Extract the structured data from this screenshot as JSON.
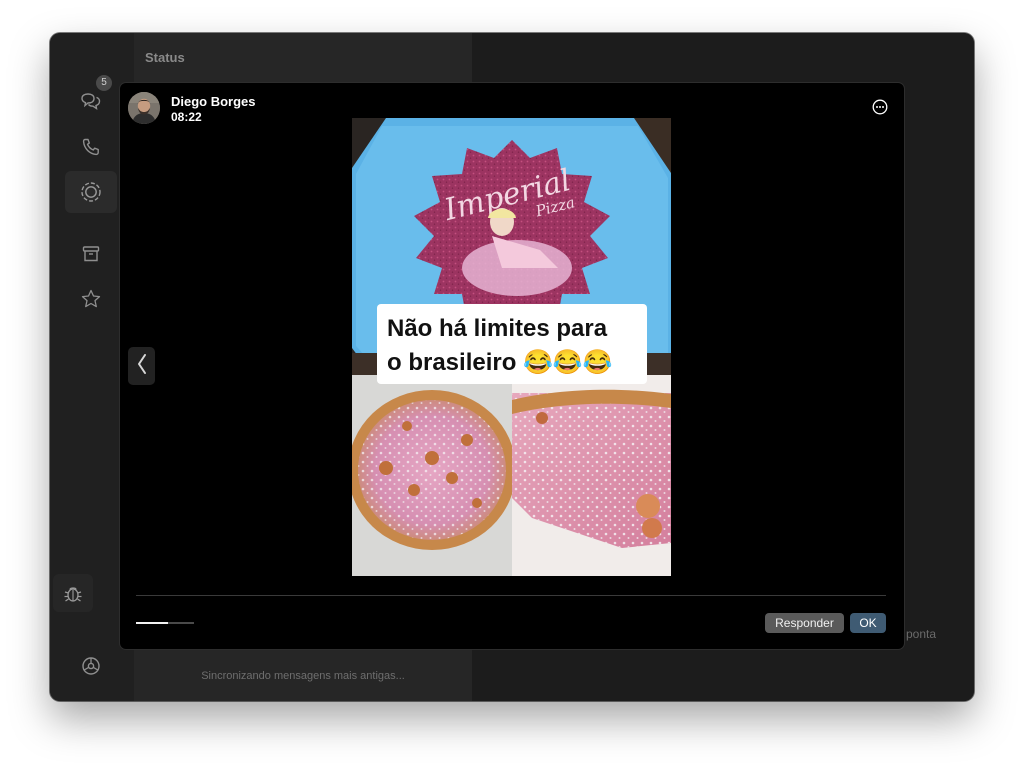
{
  "window": {
    "traffic_lights": [
      "close",
      "minimize",
      "maximize"
    ]
  },
  "sidebar": {
    "items": [
      {
        "name": "chats",
        "icon": "chat-bubbles-icon",
        "badge": "5"
      },
      {
        "name": "calls",
        "icon": "phone-icon"
      },
      {
        "name": "status",
        "icon": "status-ring-icon",
        "active": true
      },
      {
        "name": "archived",
        "icon": "archive-box-icon"
      },
      {
        "name": "starred",
        "icon": "star-icon"
      },
      {
        "name": "debug",
        "icon": "bug-icon"
      },
      {
        "name": "settings",
        "icon": "gear-icon"
      }
    ]
  },
  "list": {
    "title": "Status",
    "sync_text": "Sincronizando mensagens mais antigas..."
  },
  "main": {
    "hint_fragment": "a ponta"
  },
  "viewer": {
    "poster": {
      "name": "Diego Borges",
      "time": "08:22"
    },
    "caption": {
      "line1": "Não há limites para",
      "line2": "o brasileiro 😂😂😂"
    },
    "story_image": {
      "box_brand": "Imperial",
      "box_sub": "Pizza"
    },
    "progress": 0.55,
    "actions": {
      "reply": "Responder",
      "ok": "OK"
    }
  },
  "colors": {
    "window_bg": "#1f1f1f",
    "viewer_bg": "#000000",
    "ok_button": "#3f5b73",
    "reply_button": "#5a5a5a",
    "pizza_box_blue": "#5bb2e6",
    "pizza_box_pink": "#a13864"
  }
}
